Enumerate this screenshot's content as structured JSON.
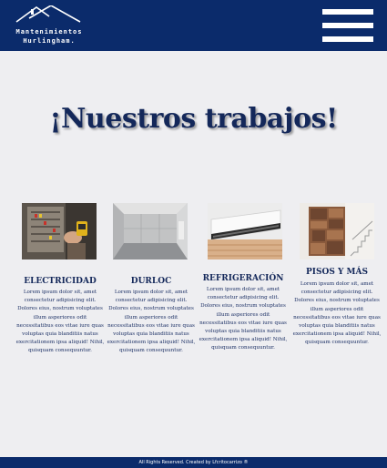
{
  "header": {
    "logo_line1": "Mantenimientos",
    "logo_line2": "Hurlingham.",
    "menu_icon": "hamburger-menu-icon",
    "color": "#0b2b6b"
  },
  "main": {
    "title": "¡Nuestros trabajos!"
  },
  "services": [
    {
      "title": "ELECTRICIDAD",
      "text": "Lorem ipsum dolor sit, amet consectetur adipisicing elit. Dolores eius, nostrum voluptates illum asperiores odit necessitatibus eos vitae iure quas voluptas quia blanditiis natus exercitationem ipsa aliquid! Nihil, quisquam consequuntur."
    },
    {
      "title": "DURLOC",
      "text": "Lorem ipsum dolor sit, amet consectetur adipisicing elit. Dolores eius, nostrum voluptates illum asperiores odit necessitatibus eos vitae iure quas voluptas quia blanditiis natus exercitationem ipsa aliquid! Nihil, quisquam consequuntur."
    },
    {
      "title": "REFRIGERACIÓN",
      "text": "Lorem ipsum dolor sit, amet consectetur adipisicing elit. Dolores eius, nostrum voluptates illum asperiores odit necessitatibus eos vitae iure quas voluptas quia blanditiis natus exercitationem ipsa aliquid! Nihil, quisquam consequuntur."
    },
    {
      "title": "PISOS Y MÁS",
      "text": "Lorem ipsum dolor sit, amet consectetur adipisicing elit. Dolores eius, nostrum voluptates illum asperiores odit necessitatibus eos vitae iure quas voluptas quia blanditiis natus exercitationem ipsa aliquid! Nihil, quisquam consequuntur."
    }
  ],
  "footer": {
    "text": "All Rights Reserved. Created by Lfcritocarrizo ®"
  }
}
